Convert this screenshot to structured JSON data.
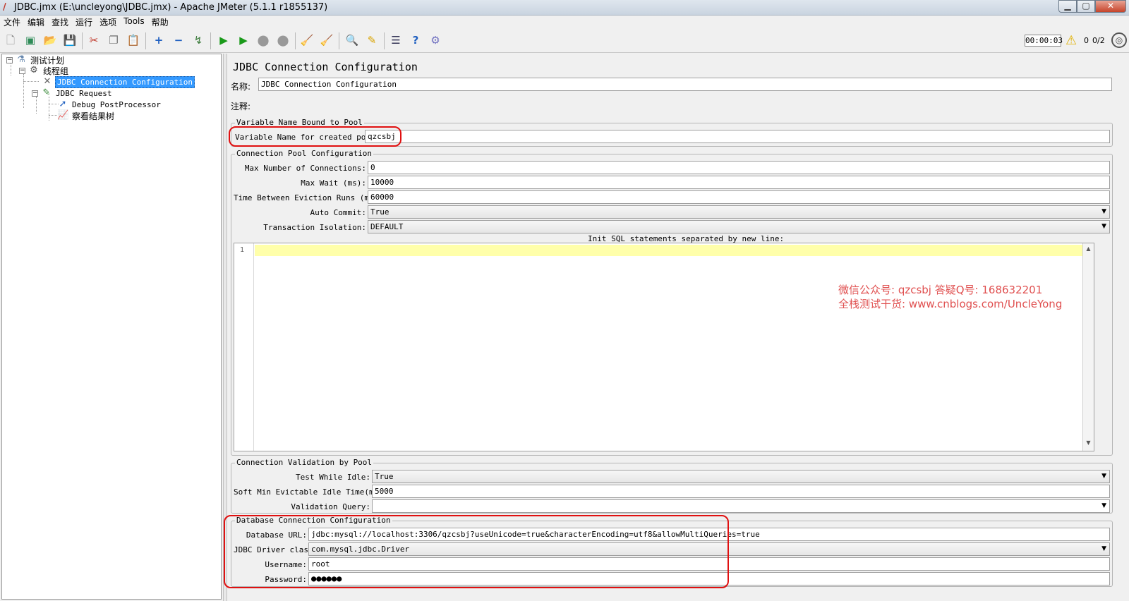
{
  "window": {
    "title": "JDBC.jmx (E:\\uncleyong\\JDBC.jmx) - Apache JMeter (5.1.1 r1855137)",
    "minimize": "▁",
    "maximize": "▢",
    "close": "✕"
  },
  "menu": [
    "文件",
    "编辑",
    "查找",
    "运行",
    "选项",
    "Tools",
    "帮助"
  ],
  "toolbar": {
    "icons": [
      "new-icon",
      "templates-icon",
      "open-icon",
      "save-icon",
      "cut-icon",
      "copy-icon",
      "paste-icon",
      "expand-icon",
      "collapse-icon",
      "toggle-icon",
      "start-icon",
      "start-no-pause-icon",
      "stop-icon",
      "shutdown-icon",
      "clear-icon",
      "clear-all-icon",
      "search-icon",
      "reset-search-icon",
      "function-helper-icon",
      "help-icon",
      "remote-icon"
    ],
    "timer": "00:00:03",
    "error_count": "0",
    "thread_count": "0/2"
  },
  "tree": {
    "items": [
      {
        "label": "测试计划",
        "icon": "test-plan-icon"
      },
      {
        "label": "线程组",
        "icon": "thread-group-icon"
      },
      {
        "label": "JDBC Connection Configuration",
        "icon": "config-element-icon",
        "selected": true
      },
      {
        "label": "JDBC Request",
        "icon": "sampler-icon"
      },
      {
        "label": "Debug PostProcessor",
        "icon": "postprocessor-icon"
      },
      {
        "label": "察看结果树",
        "icon": "listener-icon"
      }
    ]
  },
  "panel": {
    "title": "JDBC Connection Configuration",
    "name_label": "名称:",
    "name_value": "JDBC Connection Configuration",
    "comments_label": "注释:",
    "comments_value": "",
    "pool_bound": {
      "title": "Variable Name Bound to Pool",
      "var_label": "Variable Name for created pool:",
      "var_value": "qzcsbj"
    },
    "pool_config": {
      "title": "Connection Pool Configuration",
      "max_conn_label": "Max Number of Connections:",
      "max_conn_value": "0",
      "max_wait_label": "Max Wait (ms):",
      "max_wait_value": "10000",
      "eviction_label": "Time Between Eviction Runs (ms):",
      "eviction_value": "60000",
      "auto_commit_label": "Auto Commit:",
      "auto_commit_value": "True",
      "isolation_label": "Transaction Isolation:",
      "isolation_value": "DEFAULT",
      "init_sql_label": "Init SQL statements separated by new line:",
      "line_number": "1"
    },
    "validation": {
      "title": "Connection Validation by Pool",
      "test_idle_label": "Test While Idle:",
      "test_idle_value": "True",
      "soft_min_label": "Soft Min Evictable Idle Time(ms):",
      "soft_min_value": "5000",
      "query_label": "Validation Query:",
      "query_value": ""
    },
    "db_config": {
      "title": "Database Connection Configuration",
      "url_label": "Database URL:",
      "url_value": "jdbc:mysql://localhost:3306/qzcsbj?useUnicode=true&characterEncoding=utf8&allowMultiQueries=true",
      "driver_label": "JDBC Driver class:",
      "driver_value": "com.mysql.jdbc.Driver",
      "username_label": "Username:",
      "username_value": "root",
      "password_label": "Password:",
      "password_value": "●●●●●●"
    }
  },
  "watermark": {
    "line1": "微信公众号: qzcsbj   答疑Q号: 168632201",
    "line2": "全栈测试干货: www.cnblogs.com/UncleYong"
  },
  "colors": {
    "selection": "#3399ff",
    "highlight_line": "#ffffaa",
    "annotation_red": "#e01010",
    "watermark": "#e05050"
  }
}
